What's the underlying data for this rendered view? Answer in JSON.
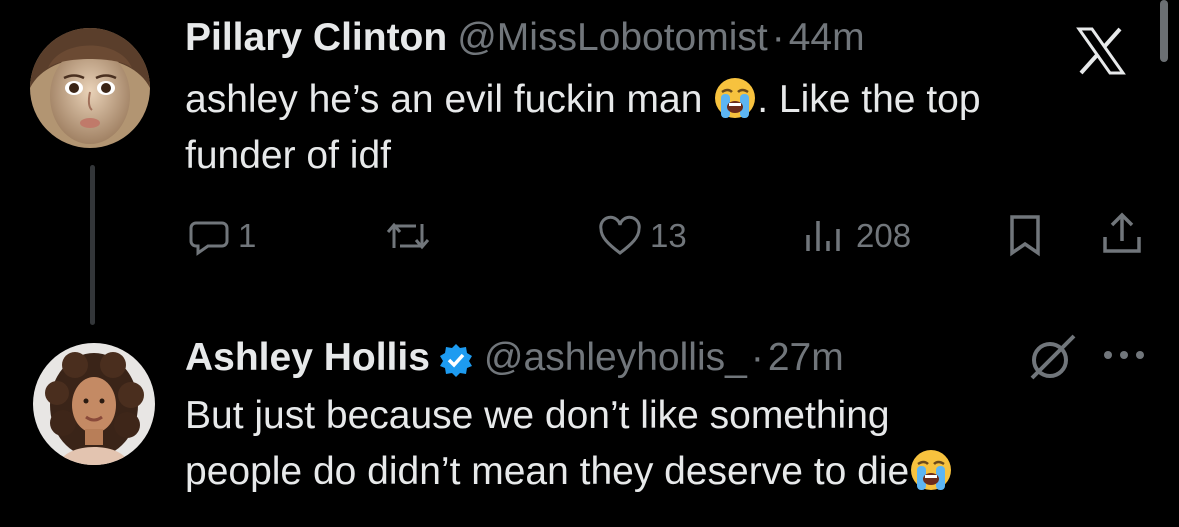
{
  "tweets": [
    {
      "author": {
        "display_name": "Pillary Clinton",
        "handle": "@MissLobotomist",
        "separator": "·",
        "time": "44m",
        "verified": false
      },
      "text_line1": "ashley he’s an evil fuckin man ",
      "text_line1_end": ". Like the top",
      "text_line2": "funder of idf",
      "emoji": "loudly-crying-face",
      "stats": {
        "replies": "1",
        "reposts": "",
        "likes": "13",
        "views": "208"
      }
    },
    {
      "author": {
        "display_name": "Ashley Hollis",
        "handle": "@ashleyhollis_",
        "separator": "·",
        "time": "27m",
        "verified": true
      },
      "text_line1": "But just because we don’t like something",
      "text_line2": "people do didn’t mean they deserve to die",
      "emoji": "loudly-crying-face"
    }
  ],
  "icons": {
    "brand": "x-logo",
    "reply": "speech-bubble-icon",
    "repost": "repost-arrows-icon",
    "like": "heart-icon",
    "views": "bar-chart-icon",
    "bookmark": "bookmark-icon",
    "share": "share-upload-icon",
    "grok": "slashed-circle-icon",
    "more": "ellipsis-icon"
  },
  "colors": {
    "background": "#000000",
    "primary_text": "#e7e9ea",
    "secondary_text": "#71767b",
    "verified_blue": "#1d9bf0",
    "thread_line": "#333639"
  }
}
